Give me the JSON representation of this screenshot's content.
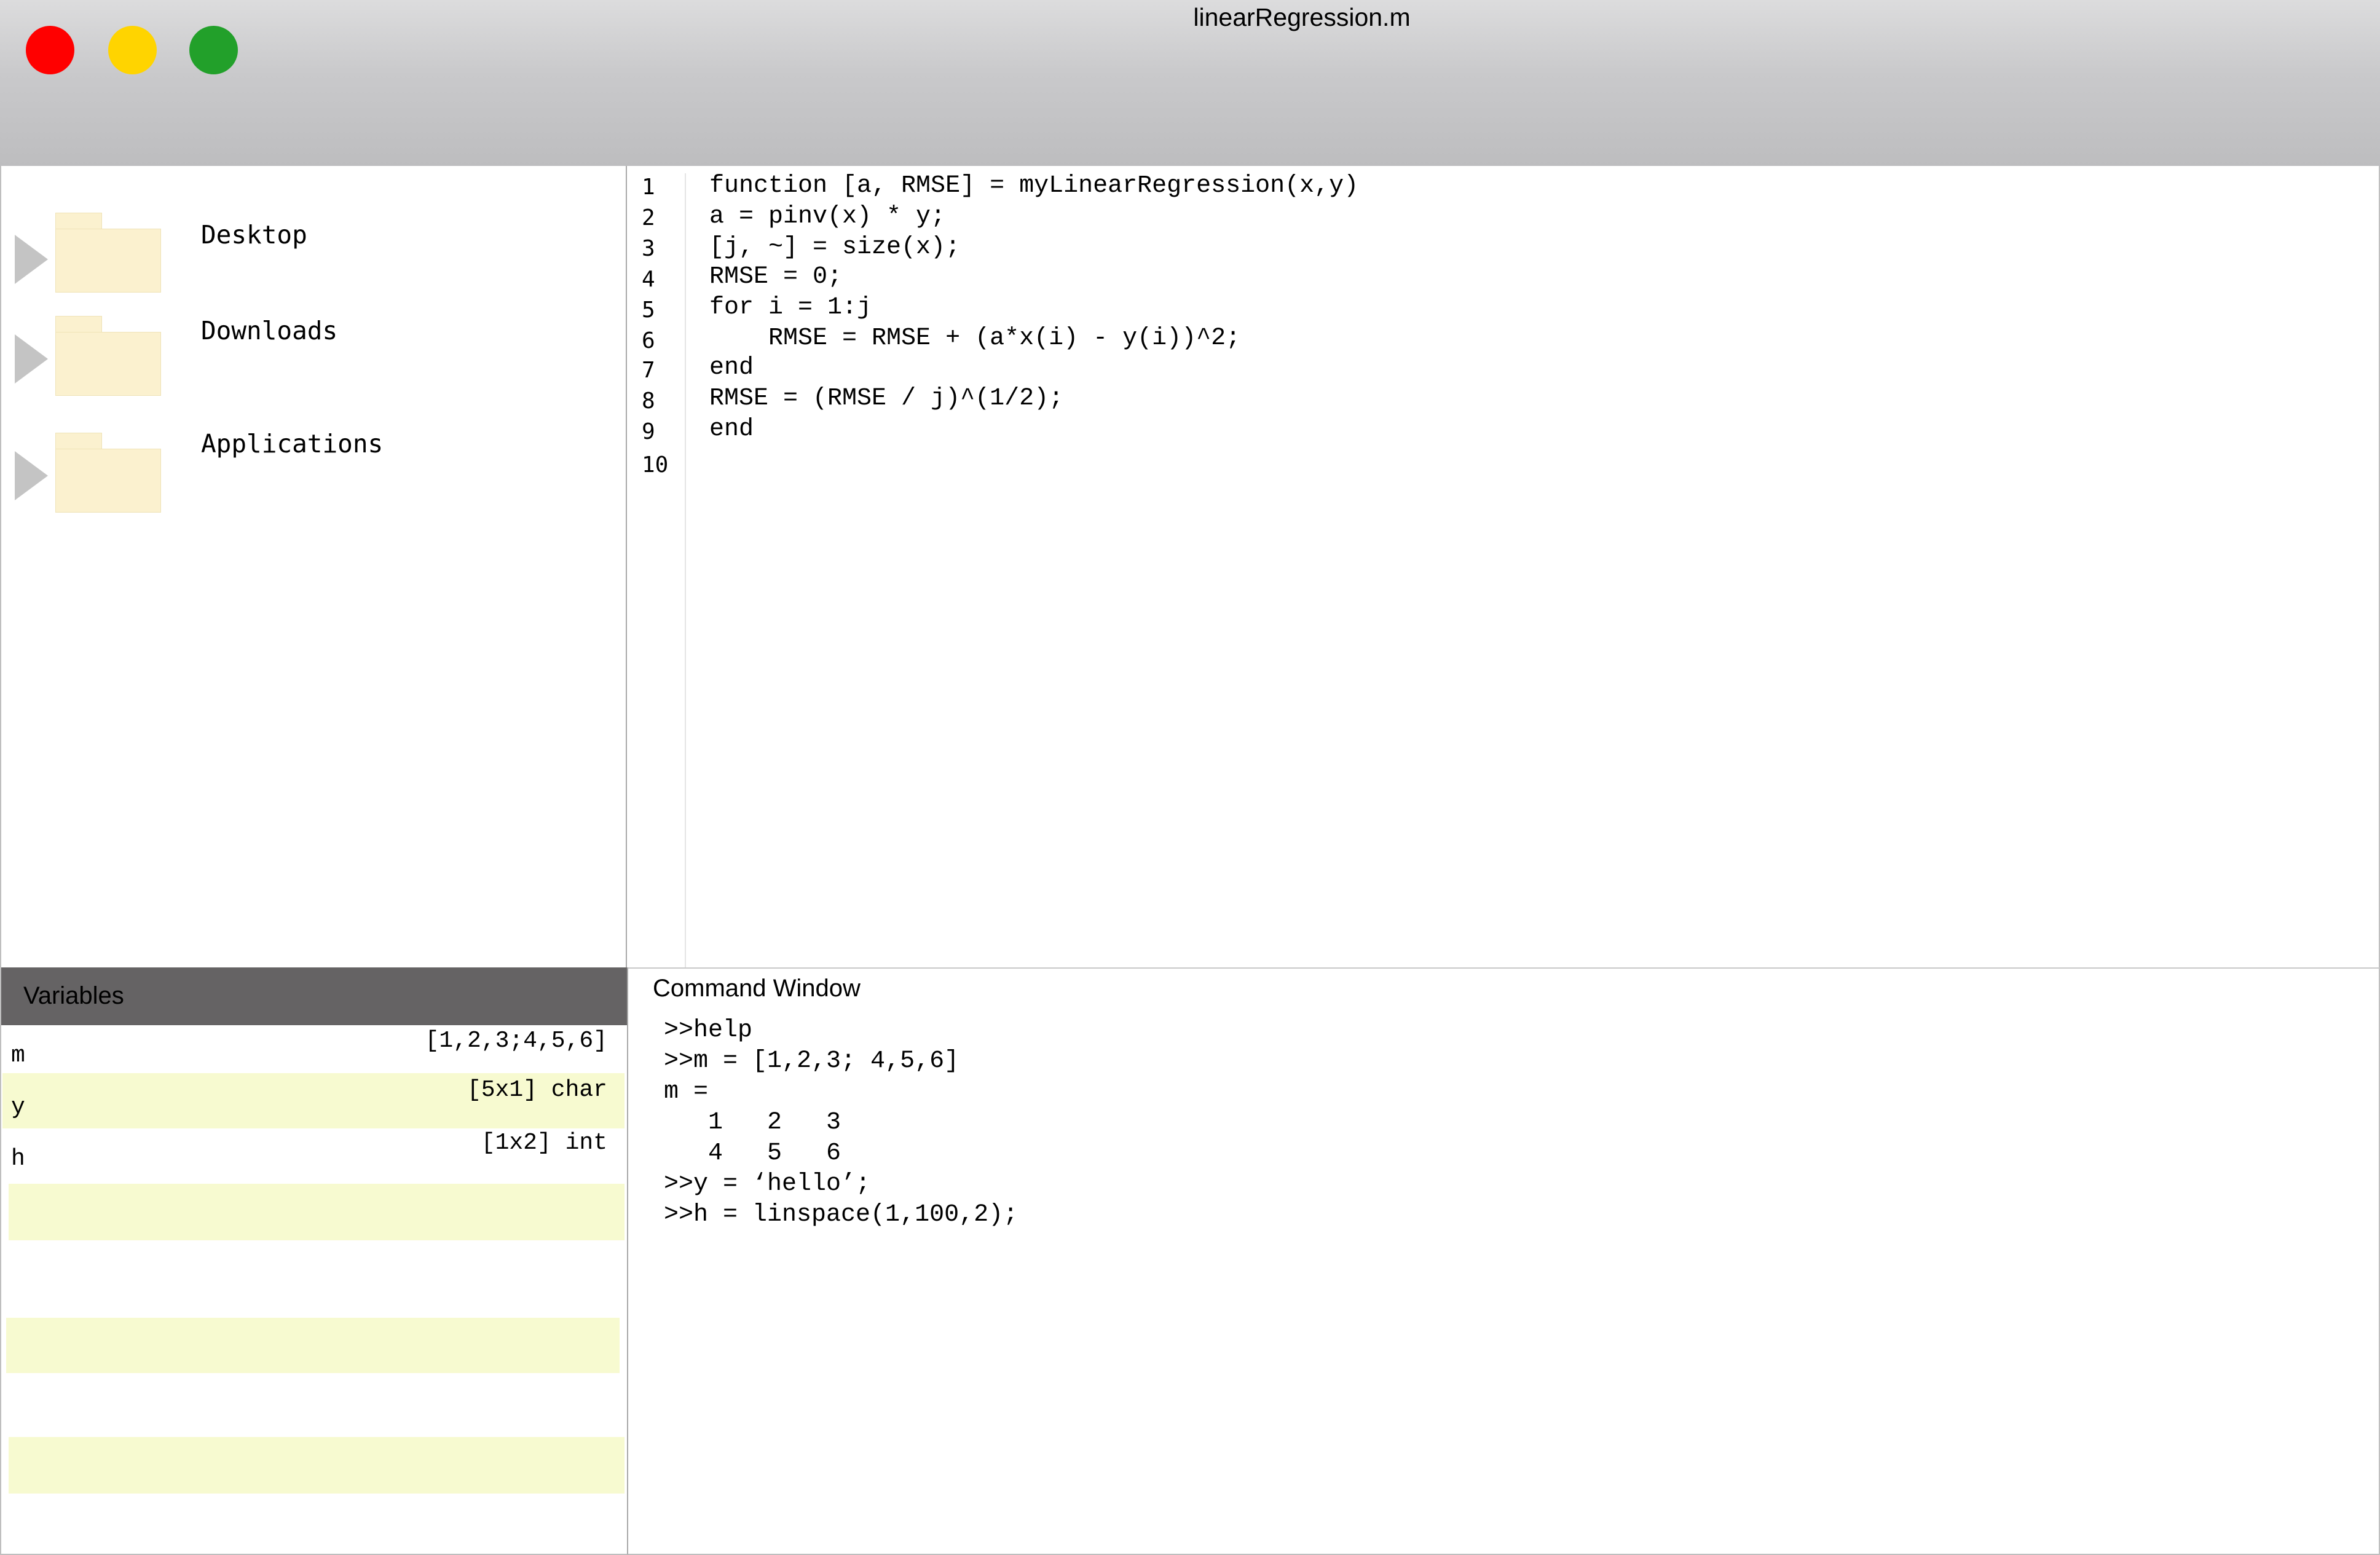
{
  "window": {
    "title": "linearRegression.m"
  },
  "file_browser": {
    "items": [
      {
        "label": "Desktop",
        "icon": "folder-icon"
      },
      {
        "label": "Downloads",
        "icon": "folder-icon"
      },
      {
        "label": "Applications",
        "icon": "folder-icon"
      }
    ]
  },
  "editor": {
    "line_numbers": [
      "1",
      "2",
      "3",
      "4",
      "5",
      "6",
      "7",
      "8",
      "9",
      "10"
    ],
    "lines": [
      "function [a, RMSE] = myLinearRegression(x,y)",
      "a = pinv(x) * y;",
      "[j, ~] = size(x);",
      "RMSE = 0;",
      "for i = 1:j",
      "    RMSE = RMSE + (a*x(i) - y(i))^2;",
      "end",
      "RMSE = (RMSE / j)^(1/2);",
      "end",
      ""
    ]
  },
  "variables": {
    "title": "Variables",
    "rows": [
      {
        "name": "m",
        "value": "[1,2,3;4,5,6]"
      },
      {
        "name": "y",
        "value": "[5x1] char"
      },
      {
        "name": "h",
        "value": "[1x2] int"
      }
    ]
  },
  "command_window": {
    "title": "Command Window",
    "lines": [
      ">>help",
      ">>m = [1,2,3; 4,5,6]",
      "m =",
      "   1   2   3",
      "   4   5   6",
      ">>y = ‘hello’;",
      ">>h = linspace(1,100,2);"
    ]
  },
  "colors": {
    "close": "#ff0000",
    "minimize": "#ffd400",
    "zoom": "#22a02a",
    "variables_header": "#656364",
    "row_stripe": "#f7fad0",
    "folder": "#fbf1cf"
  }
}
